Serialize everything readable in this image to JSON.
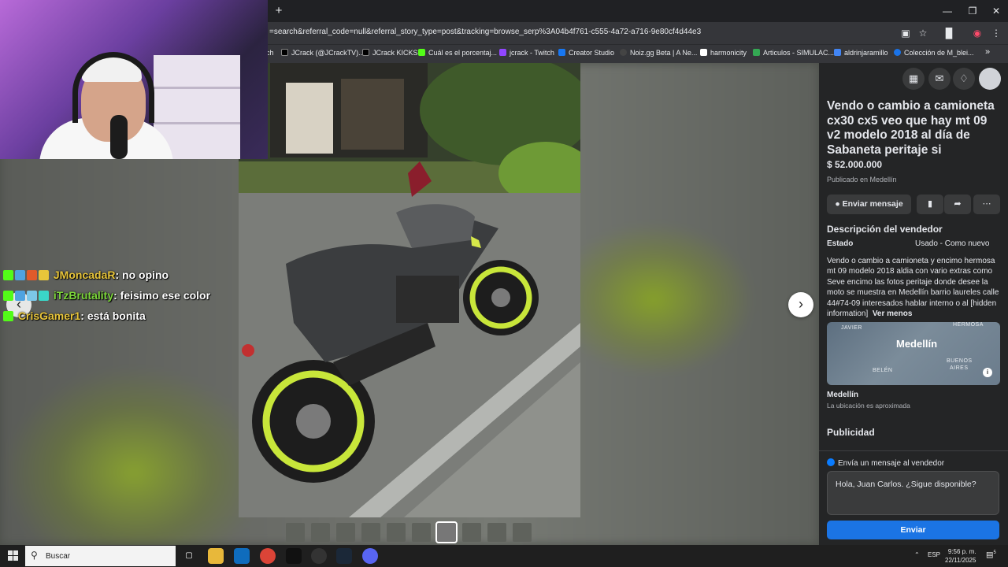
{
  "browser": {
    "url": "=search&referral_code=null&referral_story_type=post&tracking=browse_serp%3A04b4f761-c555-4a72-a716-9e80cf4d44e3",
    "new_tab": "+",
    "bookmarks": [
      {
        "label": "ch",
        "color": "#cccccc"
      },
      {
        "label": "JCrack (@JCrackTV)...",
        "color": "#000000"
      },
      {
        "label": "JCrack KICKS",
        "color": "#000000"
      },
      {
        "label": "Cuál es el porcentaj...",
        "color": "#53fc18"
      },
      {
        "label": "jcrack - Twitch",
        "color": "#9146ff"
      },
      {
        "label": "Creator Studio",
        "color": "#1877f2"
      },
      {
        "label": "Noiz.gg Beta | A Ne...",
        "color": "#444444"
      },
      {
        "label": "harmonicity",
        "color": "#ffffff"
      },
      {
        "label": "Articulos - SIMULAC...",
        "color": "#34a853"
      },
      {
        "label": "aldrinjaramillo",
        "color": "#4285f4"
      },
      {
        "label": "Colección de M_blei...",
        "color": "#1a73e8"
      }
    ],
    "more_bookmarks": "»"
  },
  "viewer": {
    "next_icon": "chevron-right-icon",
    "thumbnail_count": 10,
    "selected_thumbnail": 7
  },
  "chat": [
    {
      "user": "JMoncadaR",
      "user_color": "#e8c53a",
      "message": ": no opino"
    },
    {
      "user": "iTzBrutality",
      "user_color": "#7cd63a",
      "message": ": feisimo ese color"
    },
    {
      "user": "CrisGamer1",
      "user_color": "#e8c53a",
      "message": ": está bonita"
    }
  ],
  "listing": {
    "title": "Vendo o cambio a camioneta cx30 cx5 veo que hay mt 09 v2 modelo 2018 al día de Sabaneta peritaje si",
    "price": "$ 52.000.000",
    "published_in": "Publicado en Medellín",
    "send_message_label": "Enviar mensaje",
    "seller_description_heading": "Descripción del vendedor",
    "state_label": "Estado",
    "state_value": "Usado - Como nuevo",
    "description": "Vendo o cambio a camioneta y encimo hermosa mt 09 modelo 2018 aldia con vario extras como Seve encimo las fotos peritaje donde desee la moto se muestra en Medellín barrio laureles calle 44#74-09  interesados hablar interno o al [hidden information]",
    "see_less": "Ver menos",
    "map": {
      "city": "Medellín",
      "labels": [
        "JAVIER",
        "HERMOSA",
        "BELÉN",
        "BUENOS",
        "AIRES"
      ],
      "info_icon": "i"
    },
    "location_name": "Medellín",
    "location_note": "La ubicación es aproximada",
    "ads_heading": "Publicidad",
    "message_prompt": "Envía un mensaje al vendedor",
    "message_text": "Hola, Juan Carlos. ¿Sigue disponible?",
    "send_label": "Enviar"
  },
  "taskbar": {
    "search_placeholder": "Buscar",
    "language": "ESP",
    "time": "9:56 p. m.",
    "date": "22/11/2025",
    "notification_count": "5"
  },
  "colors": {
    "accent": "#1b74e4",
    "panel_bg": "#242526",
    "button_bg": "#3a3b3c",
    "chat_name": "#e8c53a"
  }
}
